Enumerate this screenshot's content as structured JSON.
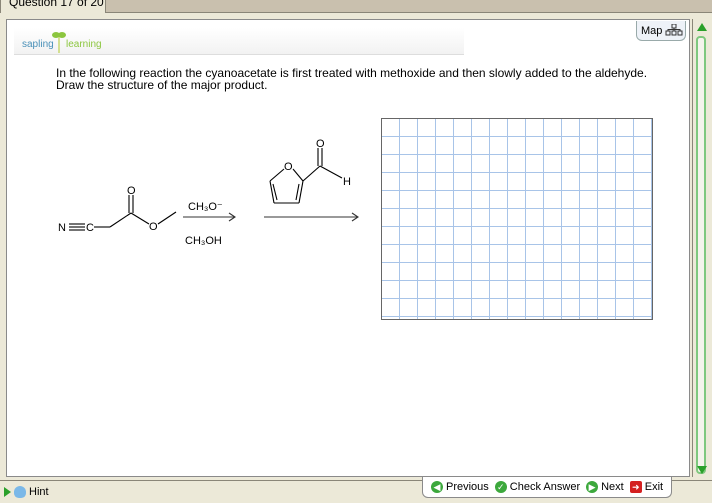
{
  "tab": {
    "title": "Question 17 of 20"
  },
  "logo": {
    "part1": "sapling",
    "part2": "learning"
  },
  "map": {
    "label": "Map",
    "icon": "sitemap-icon"
  },
  "question": {
    "text": "In the following reaction the cyanoacetate is first treated with methoxide and then slowly added to the aldehyde. Draw the structure of the major product."
  },
  "reaction": {
    "reagent_top": "CH₃O⁻",
    "reagent_bottom": "CH₃OH",
    "atoms": {
      "N": "N",
      "C": "C",
      "O": "O",
      "H": "H"
    }
  },
  "footer": {
    "hint": "Hint",
    "previous": "Previous",
    "check": "Check Answer",
    "next": "Next",
    "exit": "Exit"
  },
  "colors": {
    "accent_green": "#3ca83c",
    "grid": "#a8c4e8",
    "exit_red": "#d42020"
  }
}
